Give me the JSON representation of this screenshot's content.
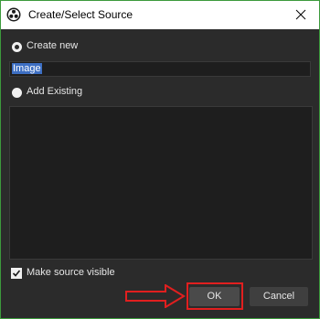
{
  "window": {
    "title": "Create/Select Source",
    "app_icon": "obs-logo-icon",
    "close_icon": "close-icon"
  },
  "options": {
    "create_new_label": "Create new",
    "create_new_selected": true,
    "name_value": "Image",
    "add_existing_label": "Add Existing",
    "add_existing_selected": false
  },
  "existing_sources": [],
  "visibility": {
    "label": "Make source visible",
    "checked": true
  },
  "buttons": {
    "ok_label": "OK",
    "cancel_label": "Cancel"
  },
  "annotation": {
    "color": "#e11f1f",
    "arrow_icon": "red-arrow-icon"
  }
}
